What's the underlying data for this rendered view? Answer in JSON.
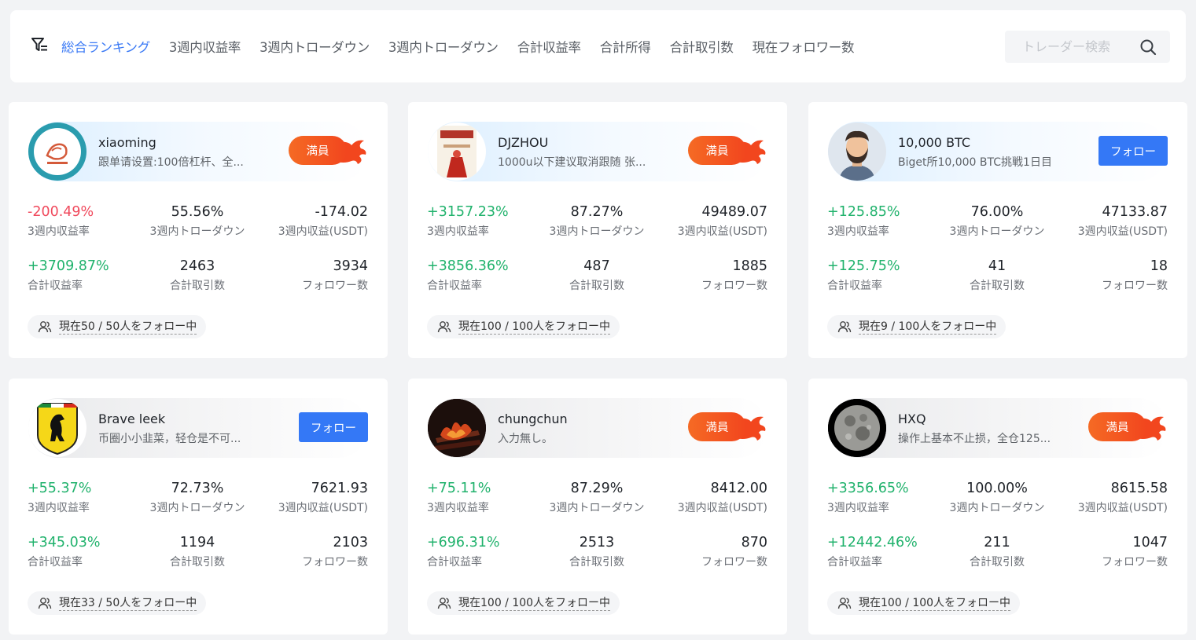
{
  "search": {
    "placeholder": "トレーダー検索"
  },
  "tabs": [
    {
      "label": "総合ランキング",
      "active": true
    },
    {
      "label": "3週内収益率",
      "active": false
    },
    {
      "label": "3週内トローダウン",
      "active": false
    },
    {
      "label": "3週内トローダウン",
      "active": false
    },
    {
      "label": "合計収益率",
      "active": false
    },
    {
      "label": "合計所得",
      "active": false
    },
    {
      "label": "合計取引数",
      "active": false
    },
    {
      "label": "現在フォロワー数",
      "active": false
    }
  ],
  "labels": {
    "full": "満員",
    "follow": "フォロー",
    "roi_3w": "3週内収益率",
    "drawdown_3w": "3週内トローダウン",
    "profit_3w": "3週内収益(USDT)",
    "roi_total": "合計収益率",
    "trades_total": "合計取引数",
    "followers": "フォロワー数"
  },
  "colors": {
    "accent": "#3478f6",
    "positive": "#20b26c",
    "negative": "#f0495c",
    "full": "#f2461e"
  },
  "traders": [
    {
      "name": "xiaoming",
      "desc": "跟单请设置:100倍杠杆、全...",
      "avatar": "logo-avatar",
      "status": "full",
      "roi_3w": "-200.49%",
      "roi_3w_sign": "negative",
      "drawdown_3w": "55.56%",
      "profit_3w": "-174.02",
      "roi_total": "+3709.87%",
      "roi_total_sign": "positive",
      "trades_total": "2463",
      "followers": "3934",
      "follow_count": "現在50 / 50人をフォロー中"
    },
    {
      "name": "DJZHOU",
      "desc": "1000u以下建议取消跟随 张...",
      "avatar": "book-avatar",
      "status": "full",
      "roi_3w": "+3157.23%",
      "roi_3w_sign": "positive",
      "drawdown_3w": "87.27%",
      "profit_3w": "49489.07",
      "roi_total": "+3856.36%",
      "roi_total_sign": "positive",
      "trades_total": "487",
      "followers": "1885",
      "follow_count": "現在100 / 100人をフォロー中"
    },
    {
      "name": "10,000 BTC",
      "desc": "Biget所10,000 BTC挑戦1日目",
      "avatar": "man-avatar",
      "status": "follow",
      "roi_3w": "+125.85%",
      "roi_3w_sign": "positive",
      "drawdown_3w": "76.00%",
      "profit_3w": "47133.87",
      "roi_total": "+125.75%",
      "roi_total_sign": "positive",
      "trades_total": "41",
      "followers": "18",
      "follow_count": "現在9 / 100人をフォロー中"
    },
    {
      "name": "Brave leek",
      "desc": "币圈小小韭菜，轻仓是不可...",
      "avatar": "horse-avatar",
      "status": "follow",
      "roi_3w": "+55.37%",
      "roi_3w_sign": "positive",
      "drawdown_3w": "72.73%",
      "profit_3w": "7621.93",
      "roi_total": "+345.03%",
      "roi_total_sign": "positive",
      "trades_total": "1194",
      "followers": "2103",
      "follow_count": "現在33 / 50人をフォロー中"
    },
    {
      "name": "chungchun",
      "desc": "入力無し。",
      "avatar": "fire-avatar",
      "status": "full",
      "roi_3w": "+75.11%",
      "roi_3w_sign": "positive",
      "drawdown_3w": "87.29%",
      "profit_3w": "8412.00",
      "roi_total": "+696.31%",
      "roi_total_sign": "positive",
      "trades_total": "2513",
      "followers": "870",
      "follow_count": "現在100 / 100人をフォロー中"
    },
    {
      "name": "HXQ",
      "desc": "操作上基本不止损，全仓125...",
      "avatar": "moon-avatar",
      "status": "full",
      "roi_3w": "+3356.65%",
      "roi_3w_sign": "positive",
      "drawdown_3w": "100.00%",
      "profit_3w": "8615.58",
      "roi_total": "+12442.46%",
      "roi_total_sign": "positive",
      "trades_total": "211",
      "followers": "1047",
      "follow_count": "現在100 / 100人をフォロー中"
    }
  ]
}
